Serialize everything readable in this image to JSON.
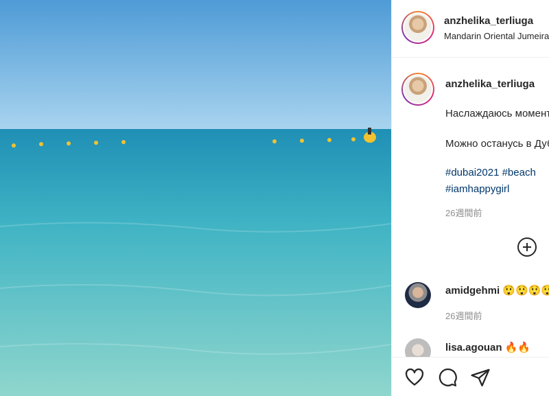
{
  "post": {
    "username": "anzhelika_terliuga",
    "location": "Mandarin Oriental Jumeira",
    "caption_line1": "Наслаждаюсь моментом",
    "caption_line2": "Можно останусь в Дубае?",
    "hashtags_line1": "#dubai2021 #beach",
    "hashtags_line2": "#iamhappygirl",
    "posted_ago": "26週間前"
  },
  "comments": [
    {
      "username": "amidgehmi",
      "text": "😲😲😲😲",
      "ago": "26週間前"
    },
    {
      "username": "lisa.agouan",
      "text": "🔥🔥"
    }
  ],
  "icons": {
    "more_options": "plus-circle-icon",
    "like": "heart-icon",
    "comment": "comment-icon",
    "share": "share-icon"
  },
  "colors": {
    "hashtag": "#00376b",
    "muted": "#8e8e8e",
    "text": "#262626",
    "border": "#efefef"
  }
}
